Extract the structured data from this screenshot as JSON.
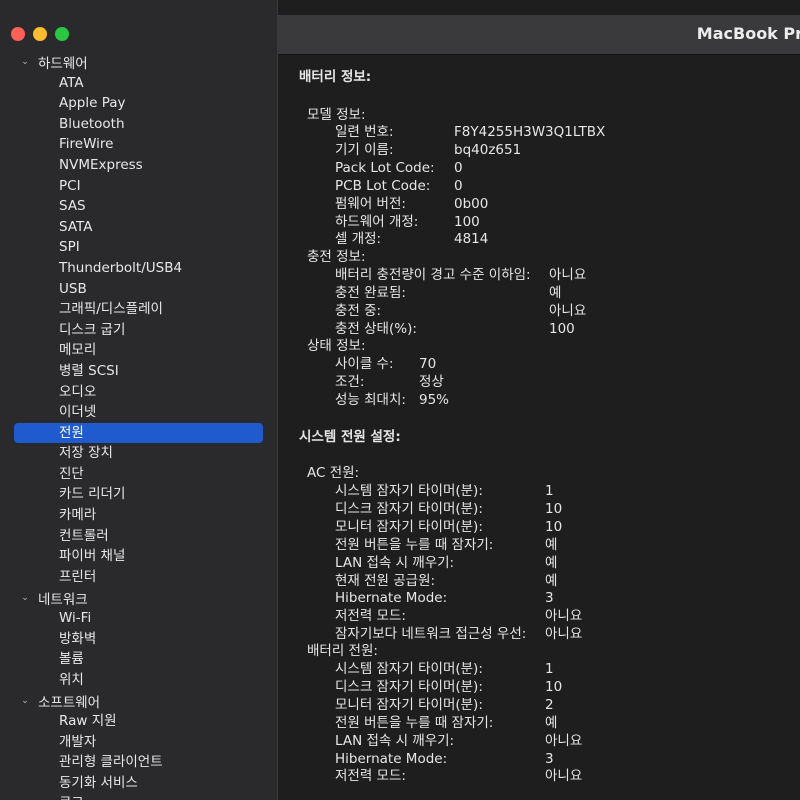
{
  "window": {
    "title": "MacBook Pro"
  },
  "sidebar": {
    "groups": [
      {
        "label": "하드웨어",
        "items": [
          "ATA",
          "Apple Pay",
          "Bluetooth",
          "FireWire",
          "NVMExpress",
          "PCI",
          "SAS",
          "SATA",
          "SPI",
          "Thunderbolt/USB4",
          "USB",
          "그래픽/디스플레이",
          "디스크 굽기",
          "메모리",
          "병렬 SCSI",
          "오디오",
          "이더넷",
          "전원",
          "저장 장치",
          "진단",
          "카드 리더기",
          "카메라",
          "컨트롤러",
          "파이버 채널",
          "프린터"
        ]
      },
      {
        "label": "네트워크",
        "items": [
          "Wi-Fi",
          "방화벽",
          "볼륨",
          "위치"
        ]
      },
      {
        "label": "소프트웨어",
        "items": [
          "Raw 지원",
          "개발자",
          "관리형 클라이언트",
          "동기화 서비스",
          "로그"
        ]
      }
    ],
    "selected": "전원"
  },
  "battery": {
    "heading": "배터리 정보:",
    "model_heading": "모델 정보:",
    "model": [
      [
        "일련 번호:",
        "F8Y4255H3W3Q1LTBX"
      ],
      [
        "기기 이름:",
        "bq40z651"
      ],
      [
        "Pack Lot Code:",
        "0"
      ],
      [
        "PCB Lot Code:",
        "0"
      ],
      [
        "펌웨어 버전:",
        "0b00"
      ],
      [
        "하드웨어 개정:",
        "100"
      ],
      [
        "셀 개정:",
        "4814"
      ]
    ],
    "charge_heading": "충전 정보:",
    "charge": [
      [
        "배터리 충전량이 경고 수준 이하임:",
        "아니요"
      ],
      [
        "충전 완료됨:",
        "예"
      ],
      [
        "충전 중:",
        "아니요"
      ],
      [
        "충전 상태(%):",
        "100"
      ]
    ],
    "status_heading": "상태 정보:",
    "status": [
      [
        "사이클 수:",
        "70"
      ],
      [
        "조건:",
        "정상"
      ],
      [
        "성능 최대치:",
        "95%"
      ]
    ]
  },
  "power_settings": {
    "heading": "시스템 전원 설정:",
    "ac_heading": "AC 전원:",
    "ac": [
      [
        "시스템 잠자기 타이머(분):",
        "1"
      ],
      [
        "디스크 잠자기 타이머(분):",
        "10"
      ],
      [
        "모니터 잠자기 타이머(분):",
        "10"
      ],
      [
        "전원 버튼을 누를 때 잠자기:",
        "예"
      ],
      [
        "LAN 접속 시 깨우기:",
        "예"
      ],
      [
        "현재 전원 공급원:",
        "예"
      ],
      [
        "Hibernate Mode:",
        "3"
      ],
      [
        "저전력 모드:",
        "아니요"
      ],
      [
        "잠자기보다 네트워크 접근성 우선:",
        "아니요"
      ]
    ],
    "battery_heading": "배터리 전원:",
    "battery": [
      [
        "시스템 잠자기 타이머(분):",
        "1"
      ],
      [
        "디스크 잠자기 타이머(분):",
        "10"
      ],
      [
        "모니터 잠자기 타이머(분):",
        "2"
      ],
      [
        "전원 버튼을 누를 때 잠자기:",
        "예"
      ],
      [
        "LAN 접속 시 깨우기:",
        "아니요"
      ],
      [
        "Hibernate Mode:",
        "3"
      ],
      [
        "저전력 모드:",
        "아니요"
      ]
    ]
  }
}
